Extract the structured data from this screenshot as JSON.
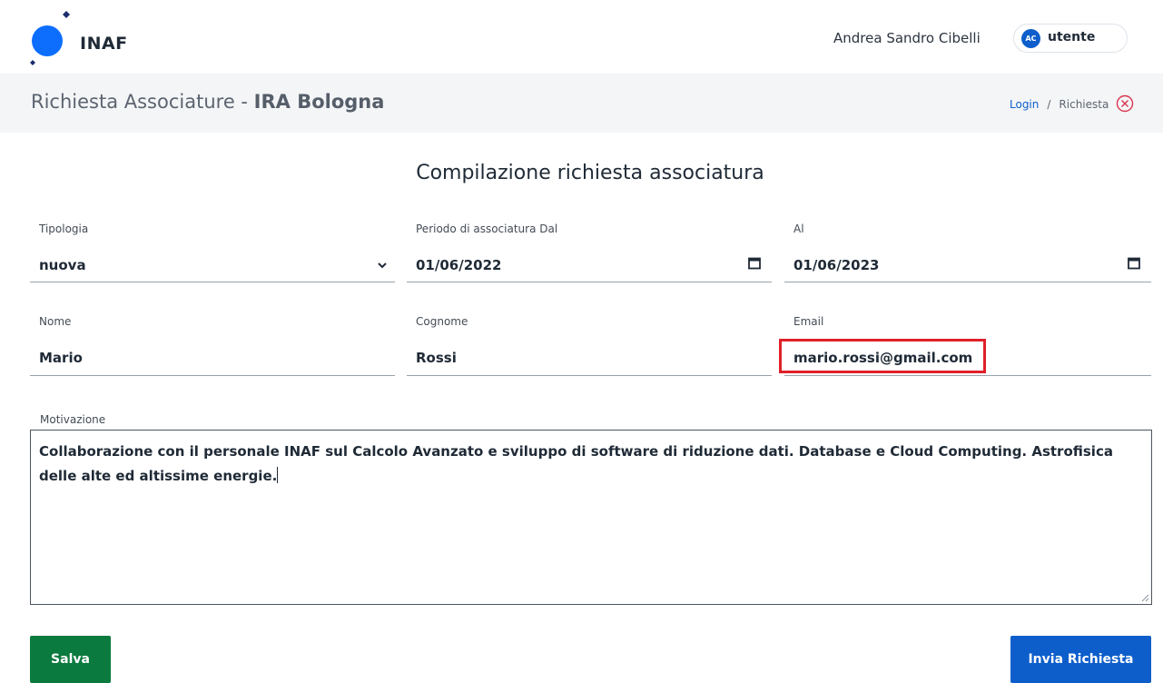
{
  "header": {
    "logo_text": "INAF",
    "user_name": "Andrea Sandro Cibelli",
    "user_initials": "AC",
    "user_role": "utente"
  },
  "subheader": {
    "title_prefix": "Richiesta Associature - ",
    "title_strong": "IRA Bologna",
    "breadcrumb": [
      {
        "label": "Login",
        "link": true
      },
      {
        "label": "Richiesta",
        "link": false
      }
    ],
    "separator": "/",
    "close_icon": "close-circle-icon"
  },
  "form": {
    "heading": "Compilazione richiesta associatura",
    "tipologia": {
      "label": "Tipologia",
      "value": "nuova"
    },
    "periodo_dal": {
      "label": "Periodo di associatura Dal",
      "value": "01/06/2022"
    },
    "periodo_al": {
      "label": "Al",
      "value": "01/06/2023"
    },
    "nome": {
      "label": "Nome",
      "value": "Mario"
    },
    "cognome": {
      "label": "Cognome",
      "value": "Rossi"
    },
    "email": {
      "label": "Email",
      "value": "mario.rossi@gmail.com"
    },
    "motivazione": {
      "label": "Motivazione",
      "value": "Collaborazione con il personale INAF sul Calcolo Avanzato e sviluppo di software di riduzione dati. Database e Cloud Computing. Astrofisica delle alte ed altissime energie."
    }
  },
  "actions": {
    "save_label": "Salva",
    "submit_label": "Invia Richiesta"
  },
  "colors": {
    "primary": "#0d5ecb",
    "success": "#0b7a3e",
    "highlight": "#e0202a",
    "danger_icon": "#d9364f"
  }
}
